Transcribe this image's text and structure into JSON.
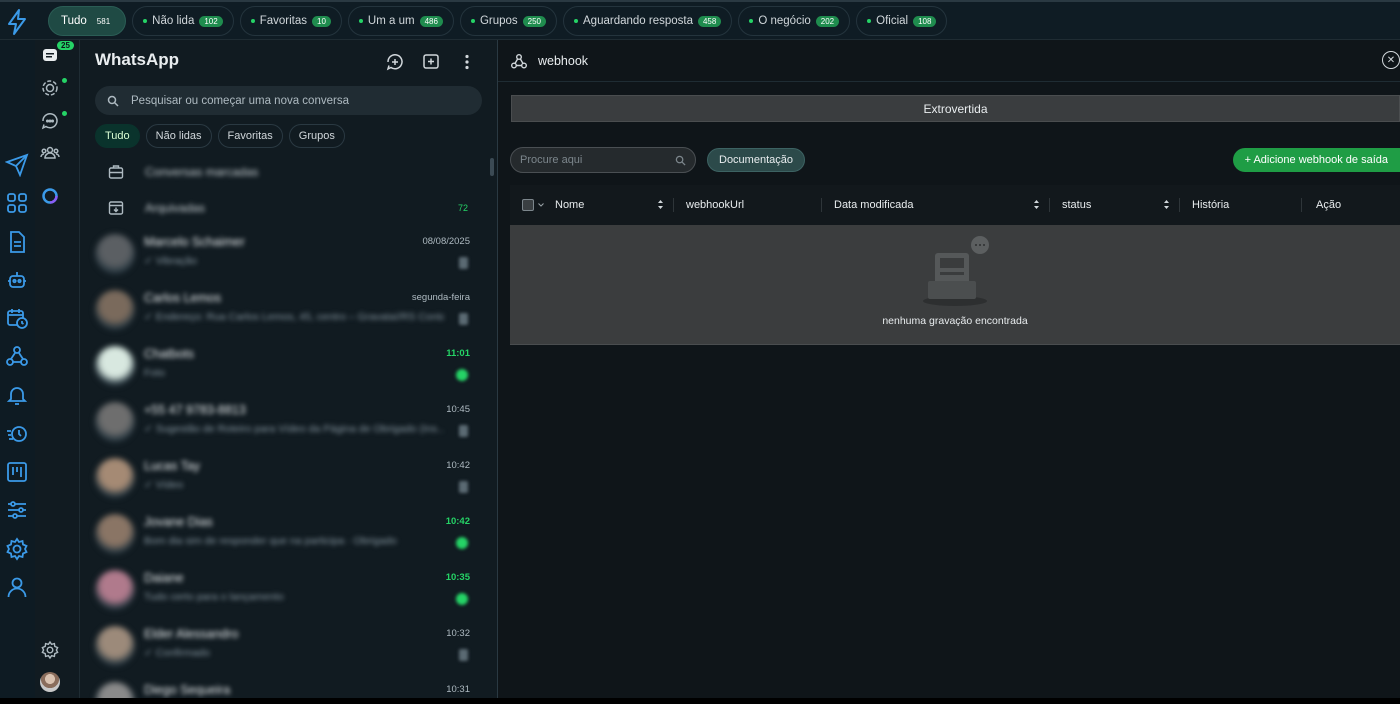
{
  "filters": [
    {
      "label": "Tudo",
      "count": "581",
      "active": true
    },
    {
      "label": "Não lida",
      "count": "102"
    },
    {
      "label": "Favoritas",
      "count": "10"
    },
    {
      "label": "Um a um",
      "count": "486"
    },
    {
      "label": "Grupos",
      "count": "250"
    },
    {
      "label": "Aguardando resposta",
      "count": "458"
    },
    {
      "label": "O negócio",
      "count": "202"
    },
    {
      "label": "Oficial",
      "count": "108"
    }
  ],
  "rail": {
    "chats_badge": "25"
  },
  "chatlist": {
    "title": "WhatsApp",
    "search_placeholder": "Pesquisar ou começar uma nova conversa",
    "tabs": [
      "Tudo",
      "Não lidas",
      "Favoritas",
      "Grupos"
    ],
    "marked_label": "Conversas marcadas",
    "archived_label": "Arquivadas",
    "archived_count": "72",
    "chats": [
      {
        "name": "Marcelo Schaimer",
        "preview": "✓ Vibração",
        "time": "08/08/2025",
        "unread": false
      },
      {
        "name": "Carlos Lemos",
        "preview": "✓ Endereço: Rua Carlos Lemos, 45, centro – Gravataí/RS Contato",
        "time": "segunda-feira",
        "unread": false
      },
      {
        "name": "Chatbots",
        "preview": "Foto",
        "time": "11:01",
        "unread": true
      },
      {
        "name": "+55 47 9783-8813",
        "preview": "✓ Sugestão de Roteiro para Vídeo da Página de Obrigado (Ins…",
        "time": "10:45",
        "unread": false
      },
      {
        "name": "Lucas Tay",
        "preview": "✓ Vídeo",
        "time": "10:42",
        "unread": false
      },
      {
        "name": "Jovane Dias",
        "preview": "Bom dia sim de responder que na participa · Obrigado",
        "time": "10:42",
        "unread": true
      },
      {
        "name": "Daiane",
        "preview": "Tudo certo para o lançamento",
        "time": "10:35",
        "unread": true
      },
      {
        "name": "Elder Alessandro",
        "preview": "✓ Confirmado",
        "time": "10:32",
        "unread": false
      },
      {
        "name": "Diego Sequeira",
        "preview": "",
        "time": "10:31",
        "unread": false
      }
    ]
  },
  "main": {
    "title": "webhook",
    "segment_label": "Extrovertida",
    "search_placeholder": "Procure aqui",
    "doc_button": "Documentação",
    "add_button": "+ Adicione webhook de saída",
    "columns": [
      "Nome",
      "webhookUrl",
      "Data modificada",
      "status",
      "História",
      "Ação"
    ],
    "empty_text": "nenhuma gravação encontrada"
  },
  "colors": {
    "accent": "#25d366",
    "brand_blue": "#3b9ae8",
    "add_button": "#1f9d45"
  }
}
